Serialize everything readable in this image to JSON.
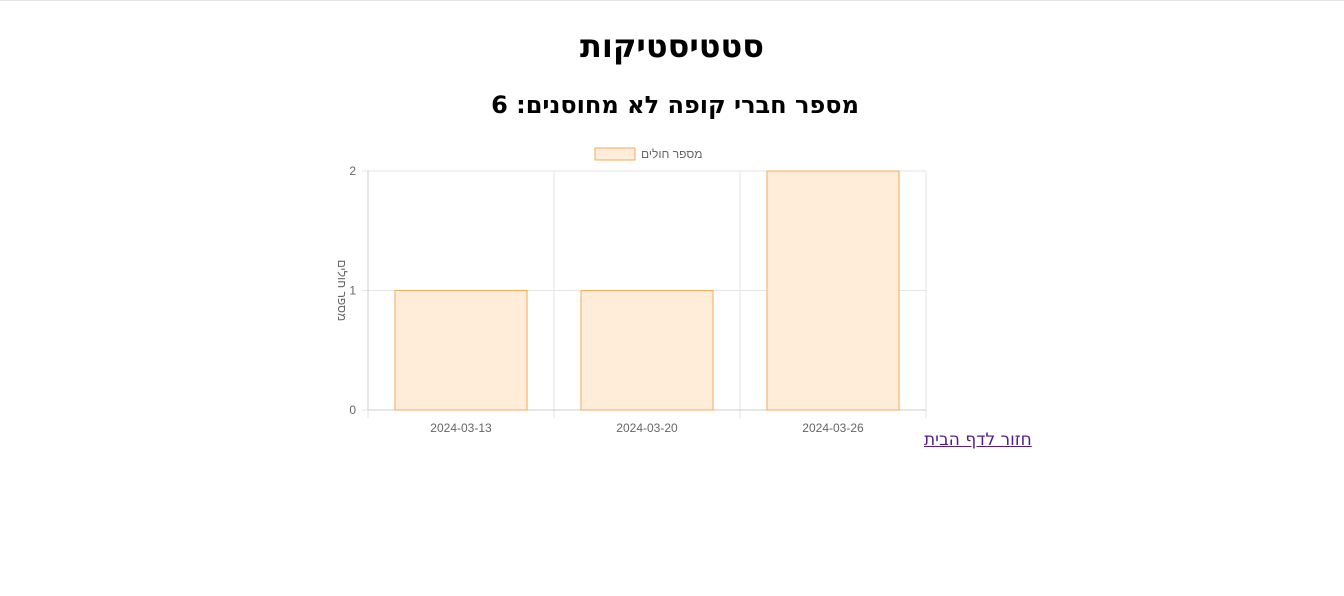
{
  "header": {
    "title": "סטטיסטיקות",
    "subtitle": "מספר חברי קופה לא מחוסנים: 6"
  },
  "nav": {
    "home_link": "חזור לדף הבית"
  },
  "colors": {
    "bar_fill": "#ffedd9",
    "bar_stroke": "#f5a95a",
    "grid": "#e6e6e6",
    "axis_text": "#666666",
    "link": "#551a8b"
  },
  "chart_data": {
    "type": "bar",
    "categories": [
      "2024-03-13",
      "2024-03-20",
      "2024-03-26"
    ],
    "series": [
      {
        "name": "מספר חולים",
        "values": [
          1,
          1,
          2
        ]
      }
    ],
    "ylabel": "מספר חולים",
    "xlabel": "",
    "ylim": [
      0,
      2
    ],
    "yticks": [
      0,
      1,
      2
    ],
    "grid": true,
    "legend": "top-center"
  }
}
